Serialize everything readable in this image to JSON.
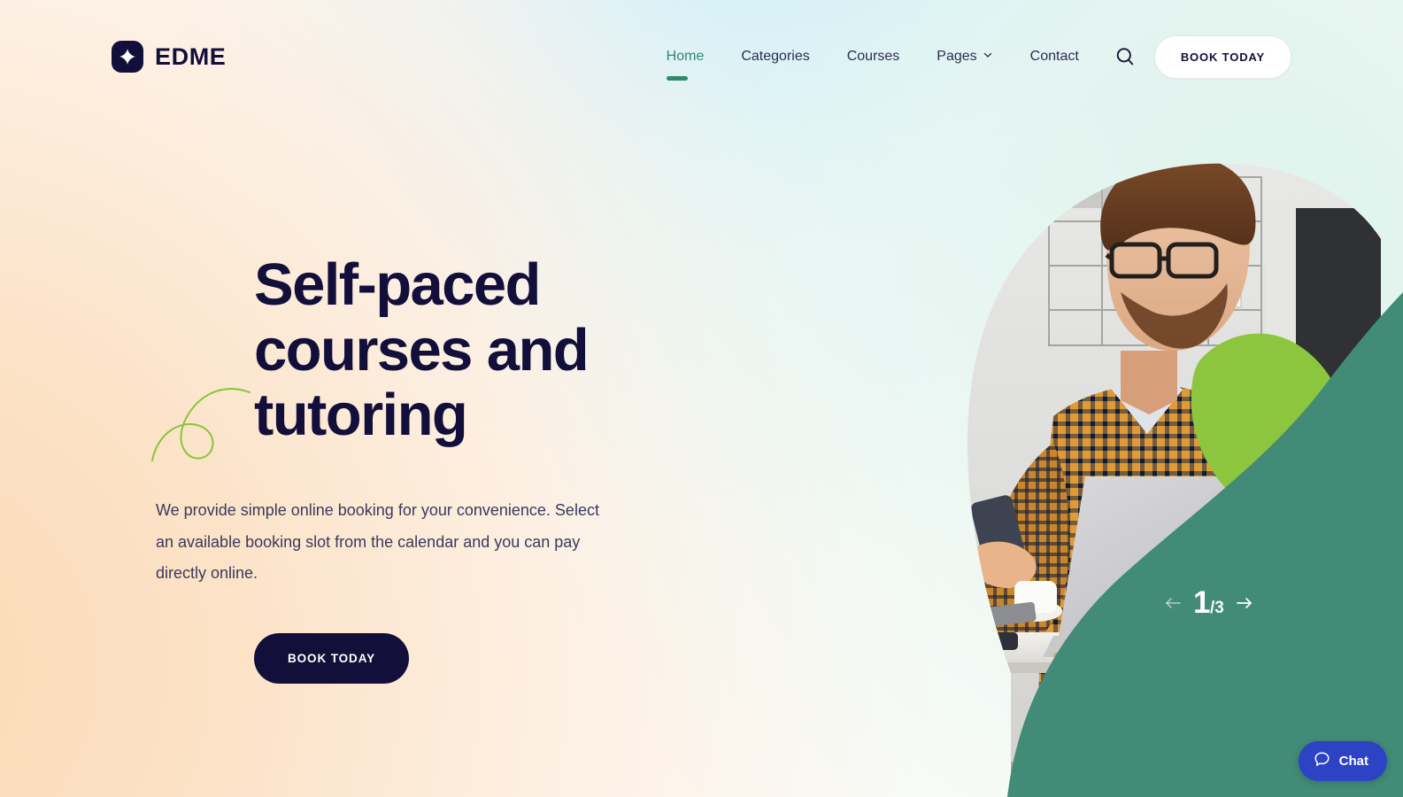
{
  "brand": {
    "name": "EDME",
    "mark_icon": "diamond-star-icon"
  },
  "nav": {
    "items": [
      {
        "label": "Home",
        "active": true,
        "has_chevron": false
      },
      {
        "label": "Categories",
        "active": false,
        "has_chevron": false
      },
      {
        "label": "Courses",
        "active": false,
        "has_chevron": false
      },
      {
        "label": "Pages",
        "active": false,
        "has_chevron": true
      },
      {
        "label": "Contact",
        "active": false,
        "has_chevron": false
      }
    ],
    "search_icon": "search-icon",
    "cta_label": "BOOK TODAY"
  },
  "hero": {
    "title": "Self-paced courses and tutoring",
    "paragraph": "We provide simple online booking for your convenience. Select an available booking slot from the calendar and you can pay directly online.",
    "cta_label": "BOOK TODAY"
  },
  "slider": {
    "current": "1",
    "total": "/3",
    "prev_icon": "arrow-left-icon",
    "next_icon": "arrow-right-icon"
  },
  "chat": {
    "label": "Chat",
    "icon": "speech-bubble-icon"
  },
  "colors": {
    "navy": "#120f3a",
    "accent_green": "#2f8a6d",
    "teal_shape": "#428b76",
    "lime_shape": "#8cc63e",
    "chat_blue": "#2b43c4",
    "body_text": "#3a3a5c"
  }
}
